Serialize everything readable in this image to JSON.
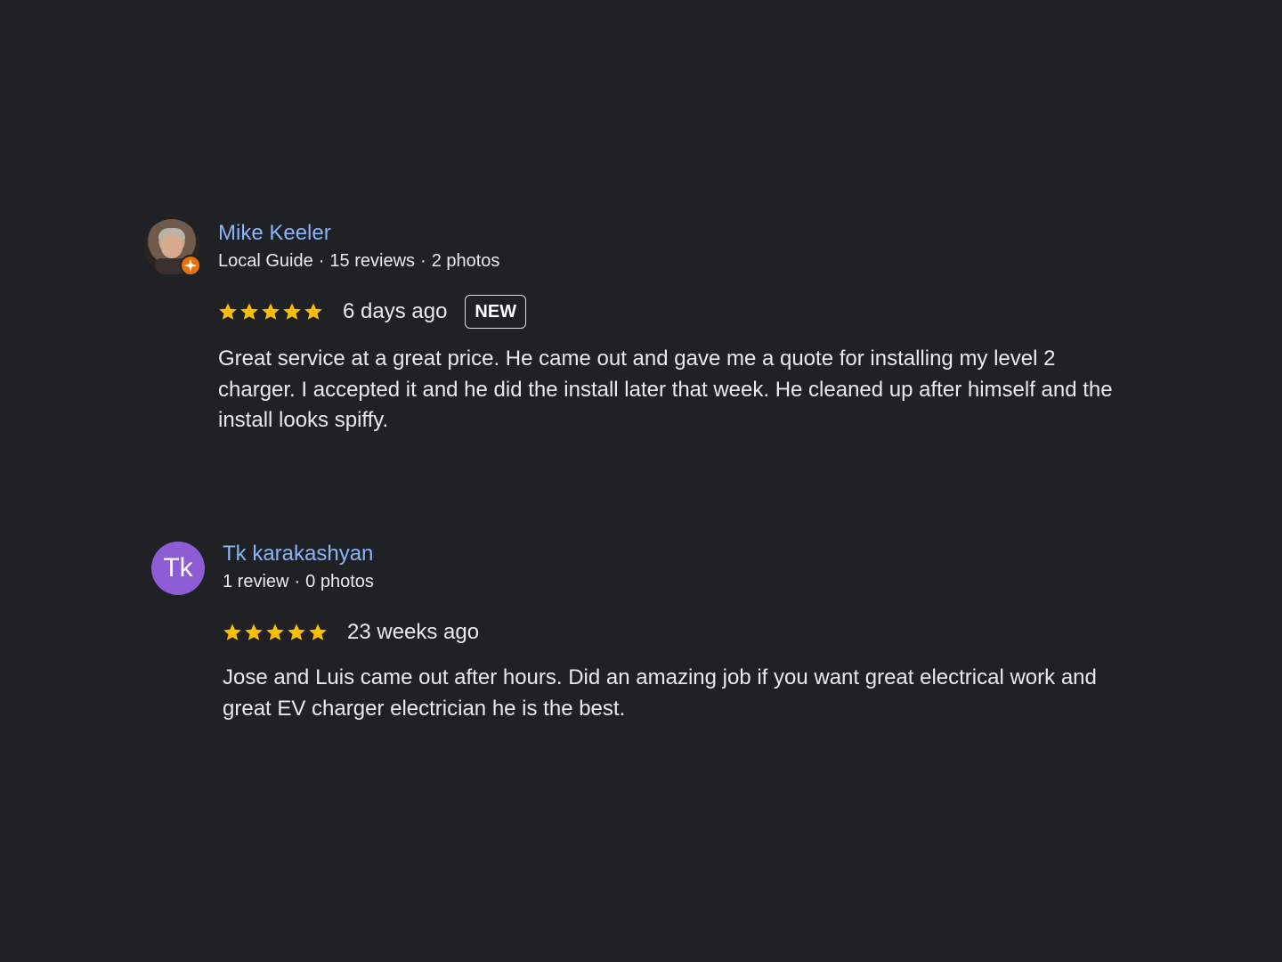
{
  "reviews": [
    {
      "name": "Mike Keeler",
      "meta": [
        "Local Guide",
        "15 reviews",
        "2 photos"
      ],
      "avatar_icon": "profile-photo",
      "badge_icon": "local-guide-star-icon",
      "rating": 5,
      "date": "6 days ago",
      "badge": "NEW",
      "text": "Great service at a great price. He came out and gave me a quote for installing my level 2 charger. I accepted it and he did the install later that week. He cleaned up after himself and the install looks spiffy."
    },
    {
      "name": "Tk karakashyan",
      "meta": [
        "1 review",
        "0 photos"
      ],
      "avatar_letter": "Tk",
      "avatar_color": "#8e5cd4",
      "rating": 5,
      "date": "23 weeks ago",
      "text": "Jose and Luis came out after hours. Did an amazing job if you want great electrical work and great EV charger electrician he is the best."
    }
  ],
  "colors": {
    "background": "#202124",
    "name_link": "#8ab4f8",
    "star": "#fbbc04",
    "guide_badge": "#e8710a"
  }
}
